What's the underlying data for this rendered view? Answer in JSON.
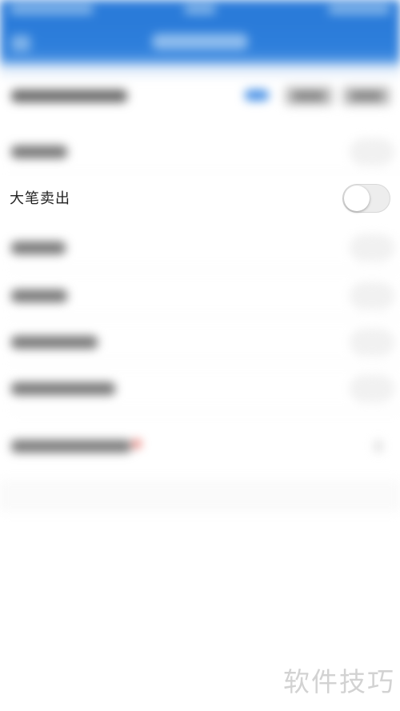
{
  "focused_setting": {
    "label": "大笔卖出",
    "toggle_on": false
  },
  "watermark": {
    "text": "软件技巧"
  },
  "colors": {
    "header_blue": "#2a7bd9",
    "text_primary": "#222222",
    "toggle_off_track": "#ededed",
    "badge_red": "#e2544a"
  },
  "icons": {
    "back": "back-arrow-icon",
    "chevron": "chevron-right-icon"
  }
}
